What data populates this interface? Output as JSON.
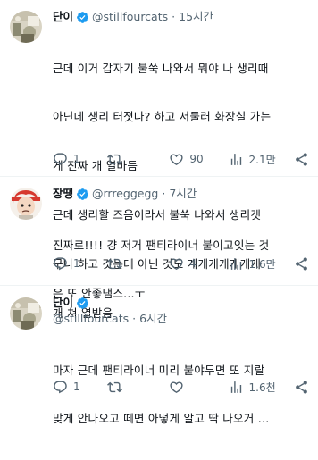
{
  "tweets": [
    {
      "name": "단이",
      "handle": "@stillfourcats",
      "dot": "·",
      "time": "15시간",
      "lines": [
        "근데 이거 갑자기 불쑥 나와서 뭐야 나 생리때",
        "아닌데 생리 터졋나? 하고 서둘러 화장실 가는",
        "게 진짜 개 열바듬",
        "근데 생리할 즈음이라서 불쑥 나와서 생리겟",
        "구나 하고 갓는데 아닌 것도 개개개개개개개",
        "개 쳐 열받음"
      ],
      "replies": "1",
      "retweets": "",
      "likes": "90",
      "views": "2.1만"
    },
    {
      "name": "장땡",
      "handle": "@rrreggegg",
      "dot": "·",
      "time": "7시간",
      "lines": [
        "진짜로!!!! 걍 저거 팬티라이너 붙이고잇는 것",
        "은 또 안좋댐스...ㅜ"
      ],
      "replies": "1",
      "retweets": "",
      "likes": "4",
      "views": "1.6만"
    },
    {
      "name": "단이",
      "handle": "@stillfourcats",
      "dot": "·",
      "time": "6시간",
      "lines": [
        "마자 근데 팬티라이너 미리 붙야두면 또 지랄",
        "맞게 안나오고 떼면 아떻게 알고 딱 나오거 ..."
      ],
      "replies": "1",
      "retweets": "",
      "likes": "",
      "views": "1.6천"
    }
  ],
  "colors": {
    "text": "#0f1419",
    "muted": "#536471",
    "verified": "#1d9bf0",
    "divider": "#eff3f4"
  },
  "icons": [
    "reply-icon",
    "retweet-icon",
    "like-icon",
    "views-icon",
    "share-icon",
    "verified-badge-icon"
  ]
}
